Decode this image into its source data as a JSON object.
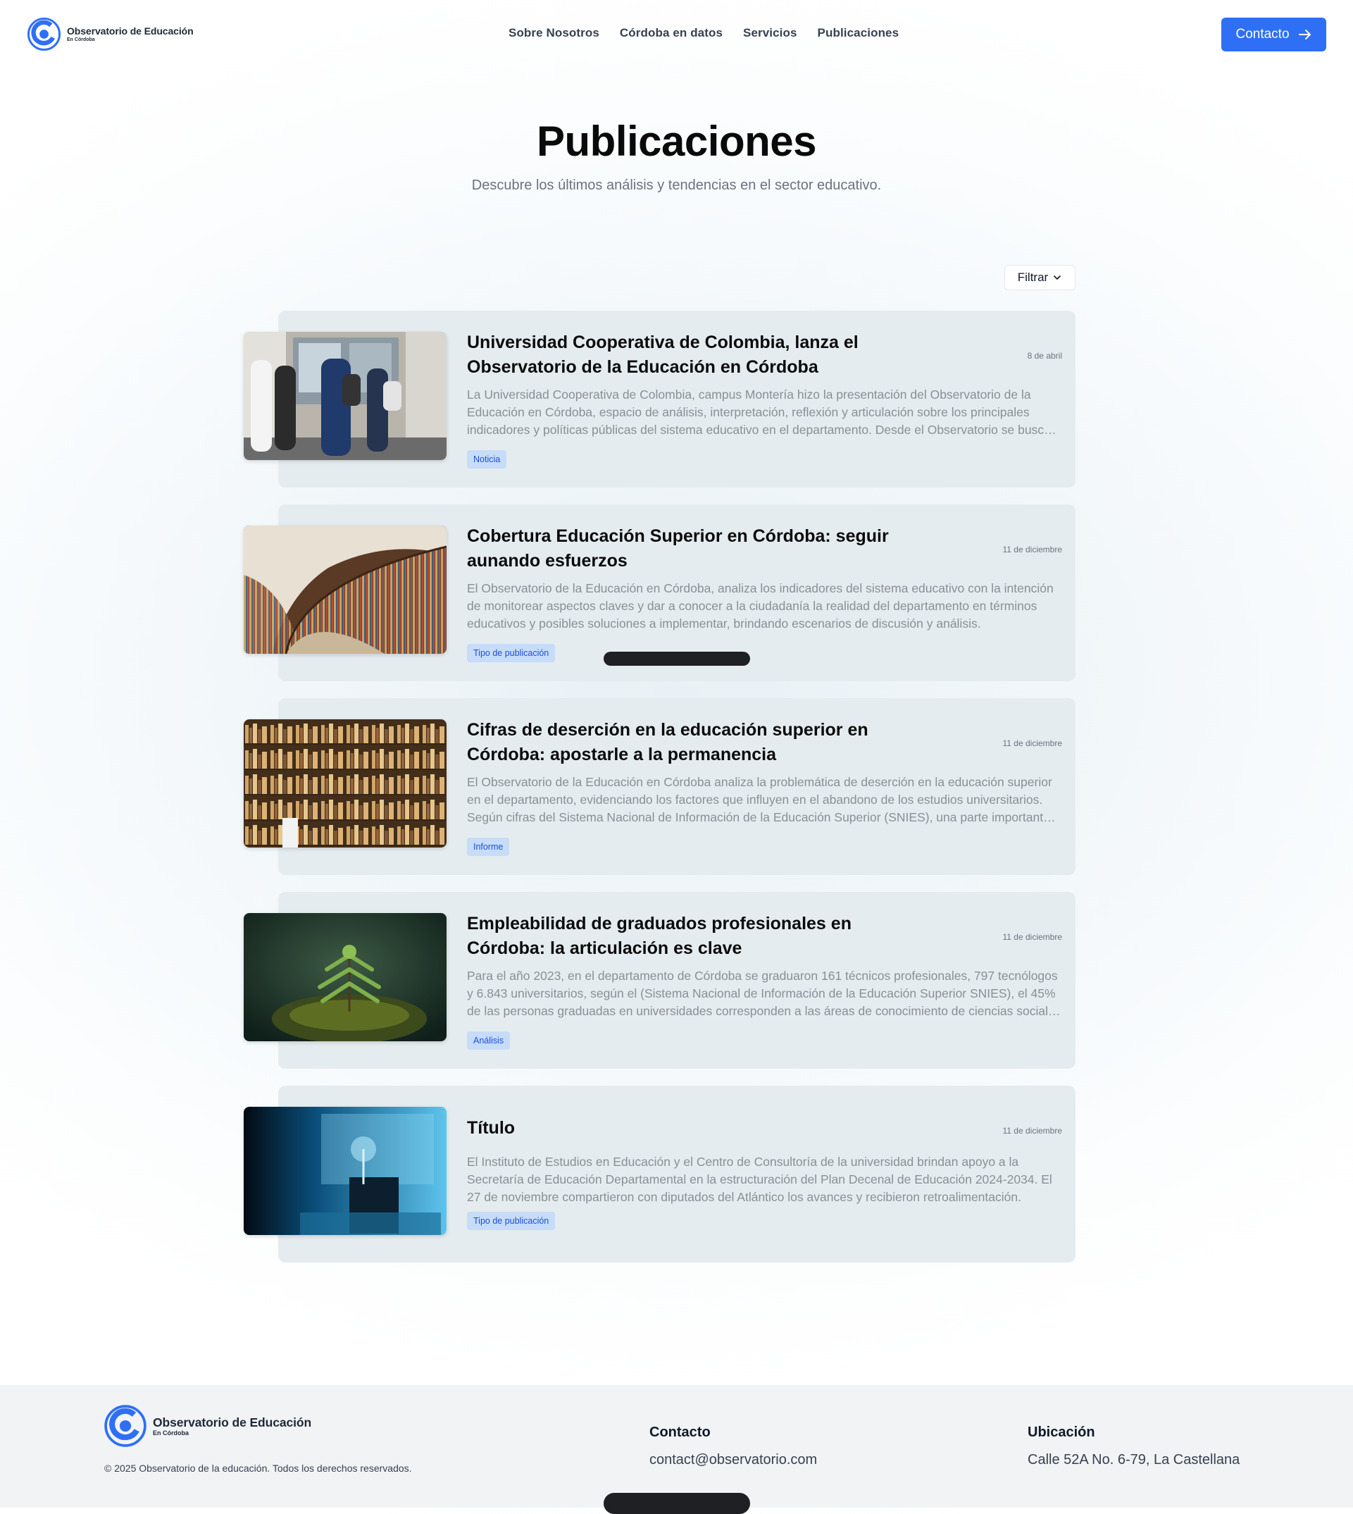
{
  "brand": {
    "name": "Observatorio de Educación",
    "tagline": "En Córdoba"
  },
  "nav": {
    "links": [
      "Sobre Nosotros",
      "Córdoba en datos",
      "Servicios",
      "Publicaciones"
    ],
    "contact_label": "Contacto"
  },
  "header": {
    "title": "Publicaciones",
    "subtitle": "Descubre los últimos análisis y tendencias en el sector educativo."
  },
  "filter": {
    "label": "Filtrar"
  },
  "publications": [
    {
      "title": "Universidad Cooperativa de Colombia, lanza el Observatorio de la Educación en Córdoba",
      "date": "8 de abril",
      "description": "La Universidad Cooperativa de Colombia, campus Montería hizo la presentación del Observatorio de la Educación en Córdoba, espacio de análisis, interpretación, reflexión y articulación sobre los principales indicadores y políticas públicas del sistema educativo en el departamento. Desde el Observatorio se busca aportar información confiable para la toma de decisiones.",
      "tag": "Noticia",
      "image": "students-hallway"
    },
    {
      "title": "Cobertura Educación Superior en Córdoba: seguir aunando esfuerzos",
      "date": "11 de diciembre",
      "description": "El Observatorio de la Educación en Córdoba, analiza los indicadores del sistema educativo con la intención de monitorear aspectos claves y dar a conocer a la ciudadanía la realidad del departamento en términos educativos y posibles soluciones a implementar, brindando escenarios de discusión y análisis.",
      "tag": "Tipo de publicación",
      "image": "curved-library"
    },
    {
      "title": "Cifras de deserción en la educación superior en Córdoba: apostarle a la permanencia",
      "date": "11 de diciembre",
      "description": "El Observatorio de la Educación en Córdoba analiza la problemática de deserción en la educación superior en el departamento, evidenciando los factores que influyen en el abandono de los estudios universitarios. Según cifras del Sistema Nacional de Información de la Educación Superior (SNIES), una parte importante de los estudiantes abandona sus estudios.",
      "tag": "Informe",
      "image": "bookshelf-wall"
    },
    {
      "title": "Empleabilidad de graduados profesionales en Córdoba: la articulación es clave",
      "date": "11 de diciembre",
      "description": "Para el año 2023, en el departamento de Córdoba se graduaron 161 técnicos profesionales, 797 tecnólogos y 6.843 universitarios, según el (Sistema Nacional de Información de la Educación Superior SNIES), el 45% de las personas graduadas en universidades corresponden a las áreas de conocimiento de ciencias sociales y humanas.",
      "tag": "Análisis",
      "image": "seedling-moss"
    },
    {
      "title": "Título",
      "date": "11 de diciembre",
      "description": "El Instituto de Estudios en Educación y el Centro de Consultoría de la universidad brindan apoyo a la Secretaría de Educación Departamental en la estructuración del Plan Decenal de Educación 2024-2034. El 27 de noviembre compartieron con diputados del Atlántico los avances y recibieron retroalimentación.",
      "tag": "Tipo de publicación",
      "image": "blue-lab"
    }
  ],
  "footer": {
    "copyright": "© 2025 Observatorio de la educación. Todos los derechos reservados.",
    "contact_heading": "Contacto",
    "contact_email": "contact@observatorio.com",
    "location_heading": "Ubicación",
    "location_address": "Calle 52A No. 6-79, La Castellana"
  },
  "colors": {
    "accent": "#2f6ff6",
    "tag_bg": "#c6dcf8",
    "tag_text": "#1d4ed8",
    "card_bg": "#e5ecef"
  }
}
